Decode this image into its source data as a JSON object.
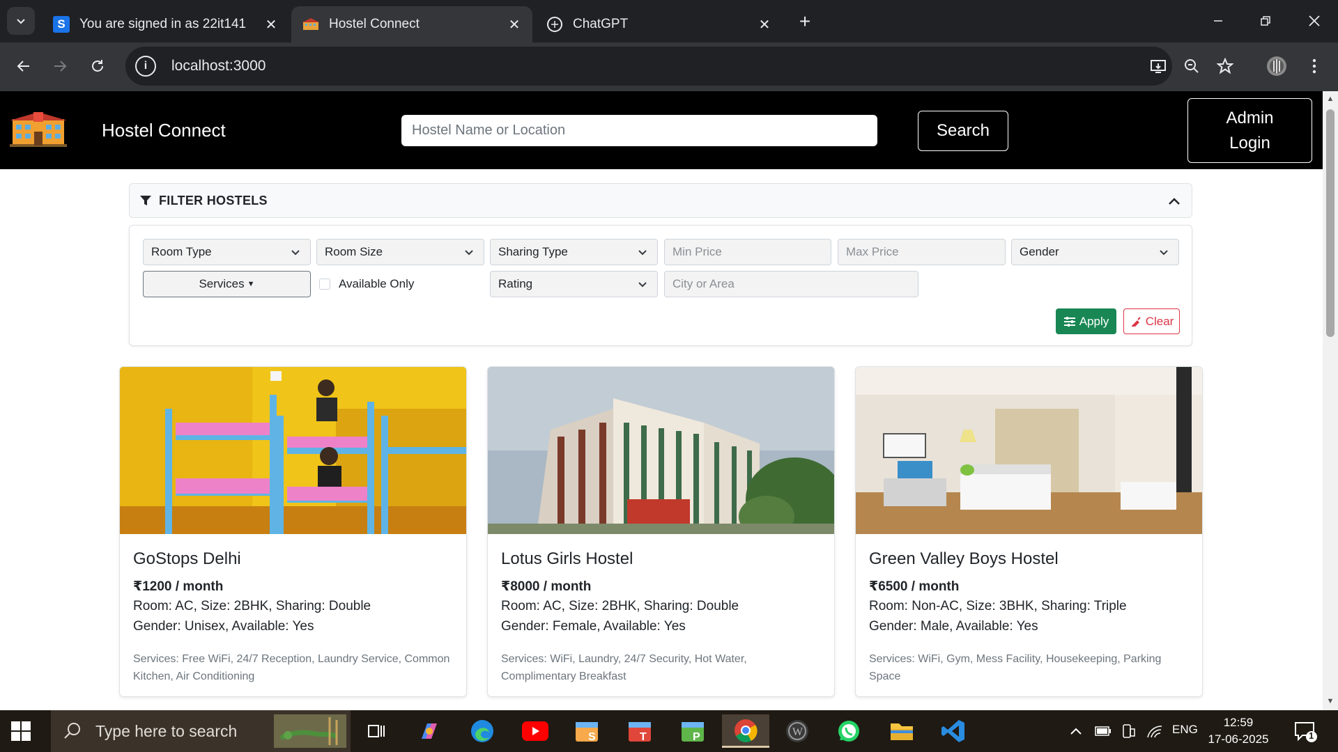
{
  "browser": {
    "tabs": [
      {
        "title": "You are signed in as 22it141",
        "favicon": "s-letter-icon",
        "active": false
      },
      {
        "title": "Hostel Connect",
        "favicon": "hostel-building-icon",
        "active": true
      },
      {
        "title": "ChatGPT",
        "favicon": "chatgpt-icon",
        "active": false
      }
    ],
    "address": "localhost:3000"
  },
  "header": {
    "brand": "Hostel Connect",
    "search_placeholder": "Hostel Name or Location",
    "search_label": "Search",
    "admin_label_line1": "Admin",
    "admin_label_line2": "Login"
  },
  "filters": {
    "title": "FILTER HOSTELS",
    "room_type": "Room Type",
    "room_size": "Room Size",
    "sharing_type": "Sharing Type",
    "min_price_placeholder": "Min Price",
    "max_price_placeholder": "Max Price",
    "gender": "Gender",
    "services": "Services",
    "available_only": "Available Only",
    "rating": "Rating",
    "city_placeholder": "City or Area",
    "apply": "Apply",
    "clear": "Clear"
  },
  "hostels": [
    {
      "name": "GoStops Delhi",
      "price": "₹1200 / month",
      "room": "Room: AC, Size: 2BHK, Sharing: Double",
      "gender": "Gender: Unisex, Available: Yes",
      "services": "Services: Free WiFi, 24/7 Reception, Laundry Service, Common Kitchen, Air Conditioning"
    },
    {
      "name": "Lotus Girls Hostel",
      "price": "₹8000 / month",
      "room": "Room: AC, Size: 2BHK, Sharing: Double",
      "gender": "Gender: Female, Available: Yes",
      "services": "Services: WiFi, Laundry, 24/7 Security, Hot Water, Complimentary Breakfast"
    },
    {
      "name": "Green Valley Boys Hostel",
      "price": "₹6500 / month",
      "room": "Room: Non-AC, Size: 3BHK, Sharing: Triple",
      "gender": "Gender: Male, Available: Yes",
      "services": "Services: WiFi, Gym, Mess Facility, Housekeeping, Parking Space"
    }
  ],
  "taskbar": {
    "search_placeholder": "Type here to search",
    "language": "ENG",
    "time": "12:59",
    "date": "17-06-2025",
    "notification_count": "1"
  },
  "colors": {
    "header_bg": "#000000",
    "apply": "#198754",
    "clear": "#dc3545",
    "chrome_dark": "#202124",
    "chrome_tab": "#35363a"
  }
}
